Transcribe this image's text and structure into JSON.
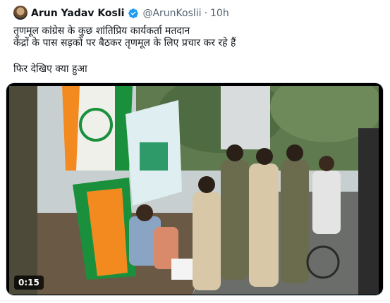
{
  "author": {
    "display_name": "Arun Yadav Kosli",
    "handle": "@ArunKoslii",
    "separator": "·",
    "timestamp": "10h",
    "verified": true
  },
  "tweet": {
    "line1": "तृणमूल कांग्रेस के कुछ शांतिप्रिय कार्यकर्ता मतदान",
    "line2": "केंद्रों के पास सड़कों पर बैठकर तृणमूल के लिए प्रचार कर रहे हैं",
    "line3": "फिर देखिए क्या हुआ"
  },
  "media": {
    "type": "video",
    "duration": "0:15"
  },
  "colors": {
    "verified": "#1d9bf0",
    "secondary_text": "#536471",
    "primary_text": "#0f1419",
    "tmc_green": "#1a8f3c",
    "tmc_saffron": "#f28a1f"
  }
}
